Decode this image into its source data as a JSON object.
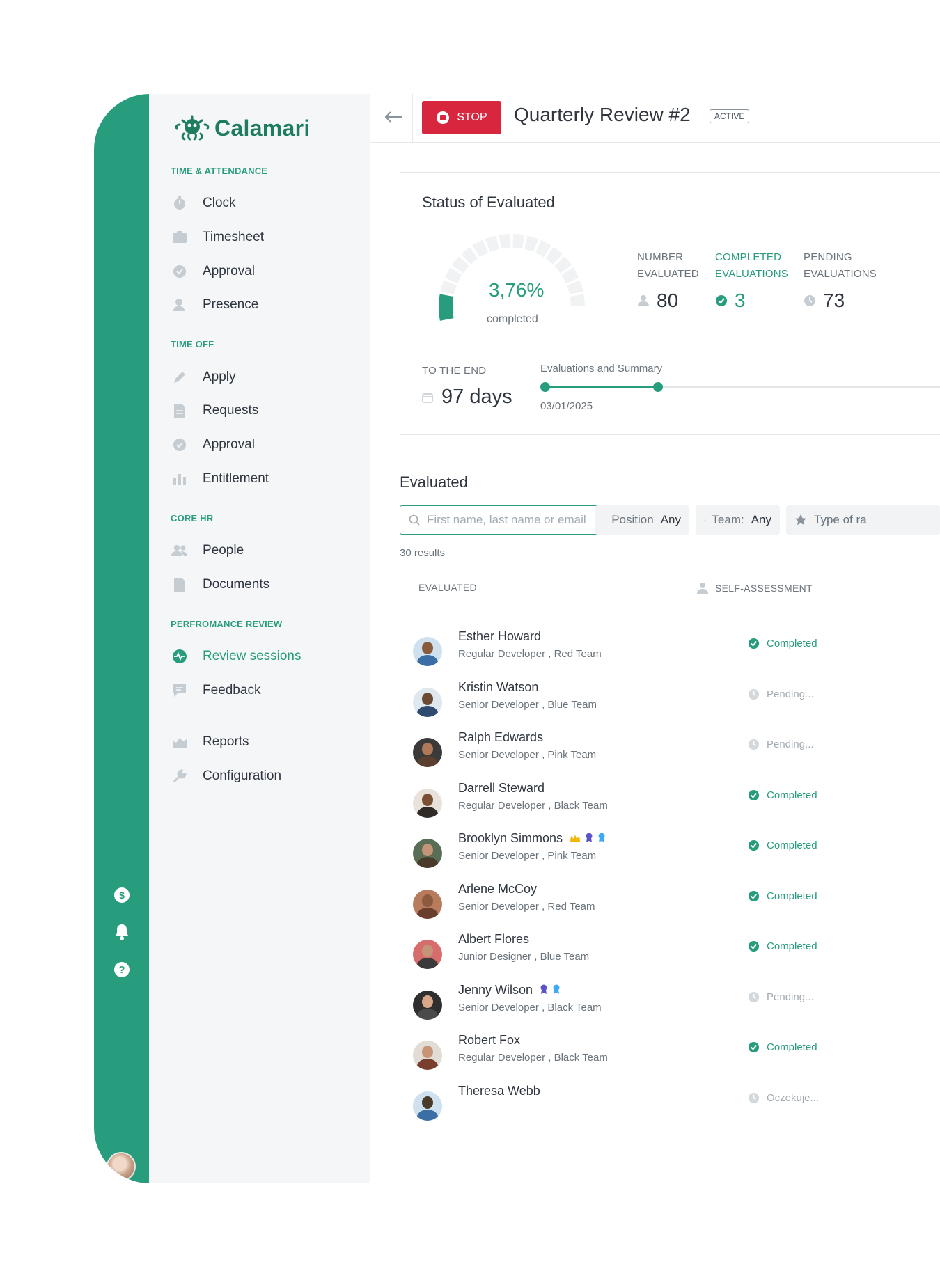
{
  "brand": {
    "name": "Calamari"
  },
  "sidebar": {
    "sections": [
      {
        "title": "TIME & ATTENDANCE",
        "items": [
          {
            "label": "Clock",
            "icon": "stopwatch-icon"
          },
          {
            "label": "Timesheet",
            "icon": "timesheet-icon"
          },
          {
            "label": "Approval",
            "icon": "check-circle-icon"
          },
          {
            "label": "Presence",
            "icon": "person-pin-icon"
          }
        ]
      },
      {
        "title": "TIME OFF",
        "items": [
          {
            "label": "Apply",
            "icon": "pencil-icon"
          },
          {
            "label": "Requests",
            "icon": "document-icon"
          },
          {
            "label": "Approval",
            "icon": "check-circle-icon"
          },
          {
            "label": "Entitlement",
            "icon": "bar-chart-icon"
          }
        ]
      },
      {
        "title": "CORE HR",
        "items": [
          {
            "label": "People",
            "icon": "people-icon"
          },
          {
            "label": "Documents",
            "icon": "folder-icon"
          }
        ]
      },
      {
        "title": "PERFROMANCE REVIEW",
        "items": [
          {
            "label": "Review sessions",
            "icon": "pulse-icon",
            "active": true
          },
          {
            "label": "Feedback",
            "icon": "feedback-icon"
          }
        ]
      },
      {
        "title": "",
        "items": [
          {
            "label": "Reports",
            "icon": "reports-icon"
          },
          {
            "label": "Configuration",
            "icon": "wrench-icon"
          }
        ]
      }
    ]
  },
  "header": {
    "stop_label": "STOP",
    "title": "Quarterly Review #2",
    "status_tag": "ACTIVE"
  },
  "status_card": {
    "title": "Status of Evaluated",
    "gauge": {
      "value_text": "3,76%",
      "caption": "completed",
      "fraction": 0.0376
    },
    "stats": [
      {
        "label_line1": "NUMBER",
        "label_line2": "EVALUATED",
        "value": "80",
        "icon": "person-icon"
      },
      {
        "label_line1": "COMPLETED",
        "label_line2": "EVALUATIONS",
        "value": "3",
        "icon": "check-circle-icon"
      },
      {
        "label_line1": "PENDING",
        "label_line2": "EVALUATIONS",
        "value": "73",
        "icon": "clock-icon"
      }
    ],
    "to_the_end_label": "TO THE END",
    "to_the_end_value": "97 days",
    "phase_label": "Evaluations and Summary",
    "phase_date": "03/01/2025"
  },
  "evaluated": {
    "heading": "Evaluated",
    "search_placeholder": "First name, last name or email",
    "filters": [
      {
        "label": "Position",
        "value": "Any",
        "icon": "briefcase-icon"
      },
      {
        "label": "Team:",
        "value": "Any",
        "icon": "team-icon"
      },
      {
        "label": "Type of ra",
        "value": "",
        "icon": "star-icon"
      }
    ],
    "results": "30 results",
    "columns": {
      "evaluated": "EVALUATED",
      "self_assessment": "SELF-ASSESSMENT"
    },
    "rows": [
      {
        "name": "Esther Howard",
        "position": "Regular Developer",
        "team": "Red Team",
        "status": "Completed",
        "state": "completed",
        "badges": []
      },
      {
        "name": "Kristin Watson",
        "position": "Senior Developer",
        "team": "Blue Team",
        "status": "Pending...",
        "state": "pending",
        "badges": []
      },
      {
        "name": "Ralph Edwards",
        "position": "Senior Developer",
        "team": "Pink Team",
        "status": "Pending...",
        "state": "pending",
        "badges": []
      },
      {
        "name": "Darrell Steward",
        "position": "Regular Developer",
        "team": "Black Team",
        "status": "Completed",
        "state": "completed",
        "badges": []
      },
      {
        "name": "Brooklyn Simmons",
        "position": "Senior Developer",
        "team": "Pink Team",
        "status": "Completed",
        "state": "completed",
        "badges": [
          "crown-icon",
          "purple-medal-icon",
          "blue-medal-icon"
        ]
      },
      {
        "name": "Arlene McCoy",
        "position": "Senior Developer",
        "team": "Red Team",
        "status": "Completed",
        "state": "completed",
        "badges": []
      },
      {
        "name": "Albert Flores",
        "position": "Junior Designer",
        "team": "Blue Team",
        "status": "Completed",
        "state": "completed",
        "badges": []
      },
      {
        "name": "Jenny Wilson",
        "position": "Senior Developer",
        "team": "Black Team",
        "status": "Pending...",
        "state": "pending",
        "badges": [
          "purple-medal-icon",
          "blue-medal-icon"
        ]
      },
      {
        "name": "Robert Fox",
        "position": "Regular Developer",
        "team": "Black Team",
        "status": "Completed",
        "state": "completed",
        "badges": []
      },
      {
        "name": "Theresa Webb",
        "position": "",
        "team": "",
        "status": "Oczekuje...",
        "state": "pending",
        "badges": []
      }
    ]
  },
  "rail": {
    "icons": [
      "currency-icon",
      "bell-icon",
      "help-icon"
    ]
  },
  "colors": {
    "brand": "#279d7d",
    "stop": "#d7263d",
    "muted": "#a3abb2"
  }
}
